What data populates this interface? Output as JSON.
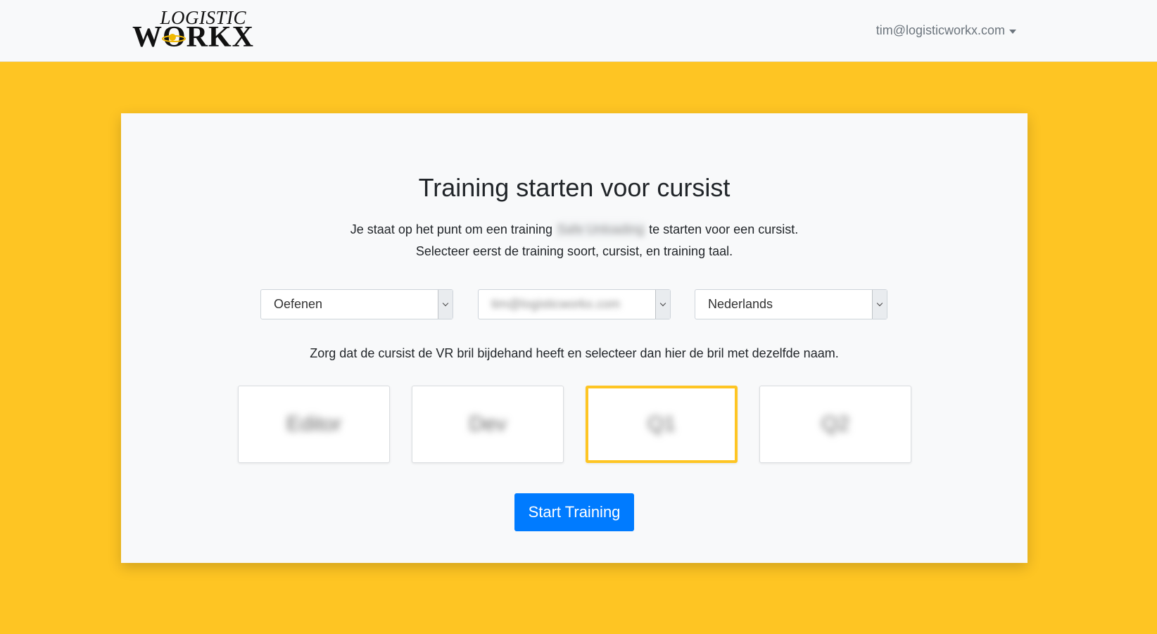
{
  "header": {
    "logo_top": "LOGISTIC",
    "logo_bottom": "WORKX",
    "user_email": "tim@logisticworkx.com"
  },
  "main": {
    "title": "Training starten voor cursist",
    "intro_before": "Je staat op het punt om een training",
    "intro_blurred": "Safe Unloading",
    "intro_after": "te starten voor een cursist.",
    "intro_line2": "Selecteer eerst de training soort, cursist, en training taal.",
    "selects": {
      "training_type": "Oefenen",
      "trainee": "tim@logisticworkx.com",
      "language": "Nederlands"
    },
    "instruction": "Zorg dat de cursist de VR bril bijdehand heeft en selecteer dan hier de bril met dezelfde naam.",
    "devices": [
      {
        "label": "Editor"
      },
      {
        "label": "Dev"
      },
      {
        "label": "Q1"
      },
      {
        "label": "Q2"
      }
    ],
    "start_button": "Start Training"
  },
  "colors": {
    "background": "#fec523",
    "primary": "#007bff",
    "selected_border": "#fec523"
  }
}
